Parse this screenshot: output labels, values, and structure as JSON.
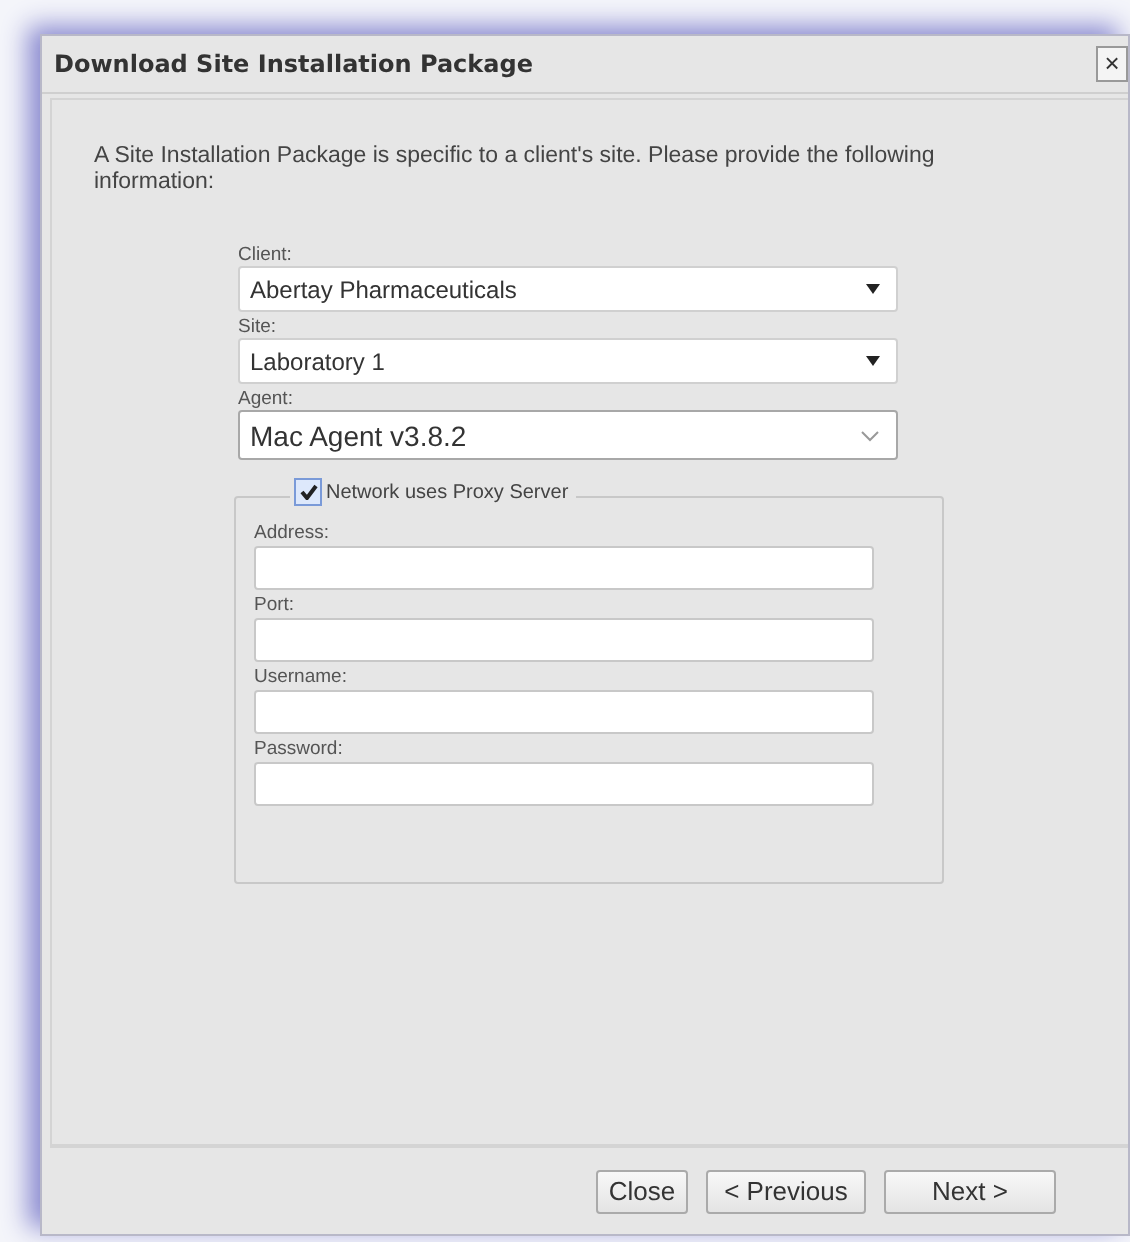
{
  "window": {
    "title": "Download Site Installation Package",
    "close": "×"
  },
  "intro": "A Site Installation Package is specific to a client's site. Please provide the following information:",
  "selects": [
    {
      "label": "Client:",
      "value": "Abertay Pharmaceuticals",
      "kind": "classic"
    },
    {
      "label": "Site:",
      "value": "Laboratory 1",
      "kind": "classic"
    },
    {
      "label": "Agent:",
      "value": "Mac Agent v3.8.2",
      "kind": "modern"
    }
  ],
  "proxy": {
    "label": "Network uses Proxy Server",
    "checked": true,
    "fields": [
      {
        "label": "Address:"
      },
      {
        "label": "Port:"
      },
      {
        "label": "Username:"
      },
      {
        "label": "Password:"
      }
    ]
  },
  "buttons": [
    "Close",
    "< Previous",
    "Next >"
  ]
}
